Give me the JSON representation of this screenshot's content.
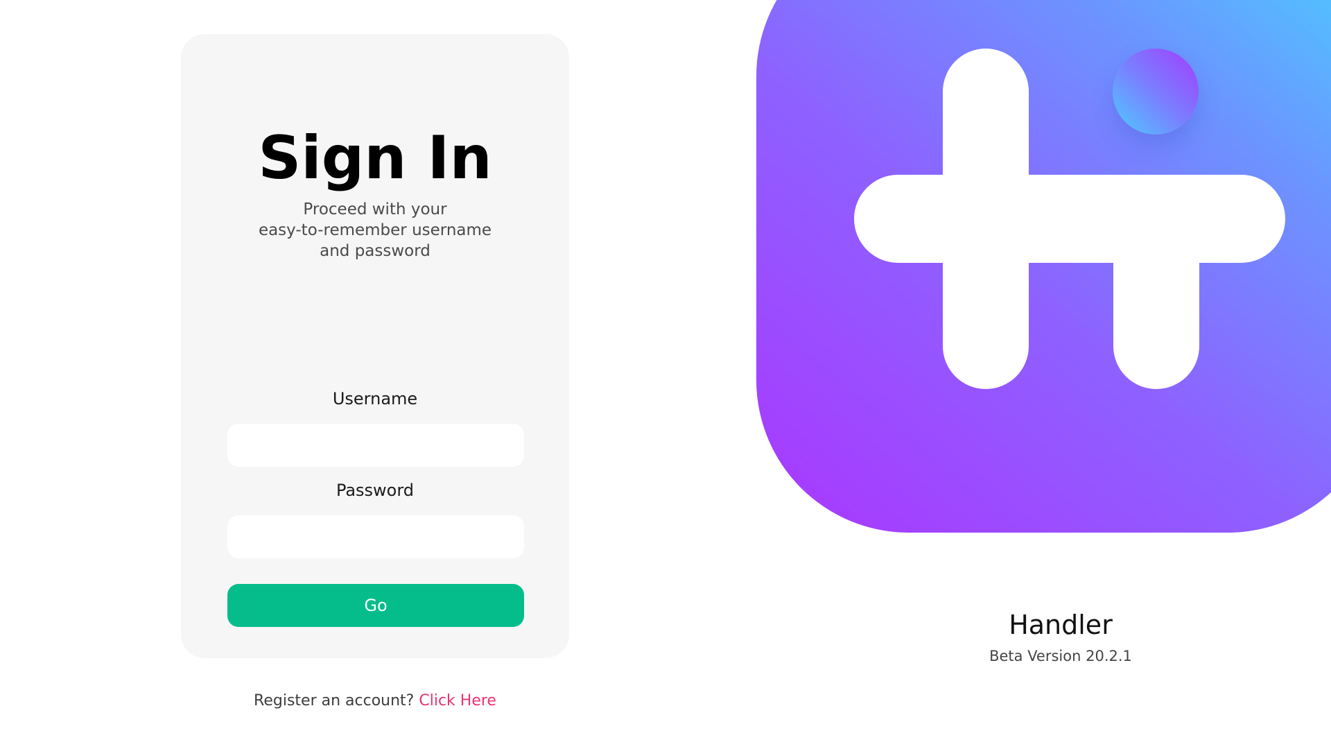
{
  "signin": {
    "title": "Sign In",
    "subtitle_lines": [
      "Proceed with your",
      "easy-to-remember username",
      "and password"
    ],
    "username_label": "Username",
    "username_value": "",
    "password_label": "Password",
    "password_value": "",
    "go_label": "Go",
    "register_prompt": "Register an account?",
    "register_link": "Click Here"
  },
  "app": {
    "logo_icon": "handler-logo-icon",
    "name": "Handler",
    "version": "Beta Version 20.2.1"
  },
  "colors": {
    "card_background": "#f6f6f6",
    "go_button": "#05bd8b",
    "register_link": "#e8336f",
    "logo_gradient_start": "#aa36ff",
    "logo_gradient_end": "#47d5ff"
  }
}
